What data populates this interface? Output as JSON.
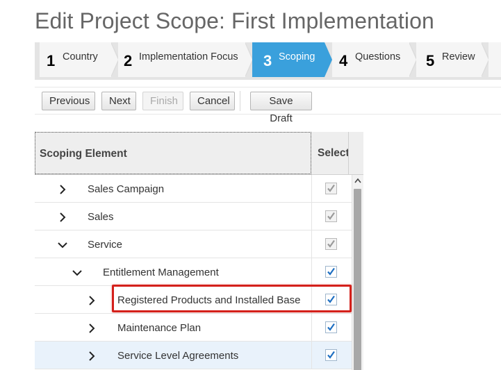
{
  "page": {
    "title": "Edit Project Scope: First Implementation"
  },
  "train": {
    "steps": [
      {
        "number": "1",
        "label": "Country",
        "active": false
      },
      {
        "number": "2",
        "label": "Implementation Focus",
        "active": false
      },
      {
        "number": "3",
        "label": "Scoping",
        "active": true
      },
      {
        "number": "4",
        "label": "Questions",
        "active": false
      },
      {
        "number": "5",
        "label": "Review",
        "active": false
      }
    ],
    "active_color": "#3aa0dc"
  },
  "toolbar": {
    "previous_label": "Previous",
    "next_label": "Next",
    "finish_label": "Finish",
    "cancel_label": "Cancel",
    "save_draft_label": "Save Draft"
  },
  "table": {
    "columns": {
      "scoping_element": "Scoping Element",
      "select": "Select"
    },
    "rows": [
      {
        "label": "Sales Campaign",
        "expanded": false,
        "level": 0,
        "checked": true,
        "editable": false,
        "chevron_icon": "chevron-right-icon"
      },
      {
        "label": "Sales",
        "expanded": false,
        "level": 0,
        "checked": true,
        "editable": false,
        "chevron_icon": "chevron-right-icon"
      },
      {
        "label": "Service",
        "expanded": true,
        "level": 0,
        "checked": true,
        "editable": false,
        "chevron_icon": "chevron-down-icon"
      },
      {
        "label": "Entitlement Management",
        "expanded": true,
        "level": 1,
        "checked": true,
        "editable": true,
        "chevron_icon": "chevron-down-icon"
      },
      {
        "label": "Registered Products and Installed Base",
        "expanded": false,
        "level": 2,
        "checked": true,
        "editable": true,
        "chevron_icon": "chevron-right-icon"
      },
      {
        "label": "Maintenance Plan",
        "expanded": false,
        "level": 2,
        "checked": true,
        "editable": true,
        "chevron_icon": "chevron-right-icon"
      },
      {
        "label": "Service Level Agreements",
        "expanded": false,
        "level": 2,
        "checked": true,
        "editable": true,
        "selected": true,
        "chevron_icon": "chevron-right-icon"
      }
    ],
    "highlight_color": "#d4201b",
    "check_color_enabled": "#1e6fc2",
    "check_color_disabled": "#9a9a9a"
  }
}
